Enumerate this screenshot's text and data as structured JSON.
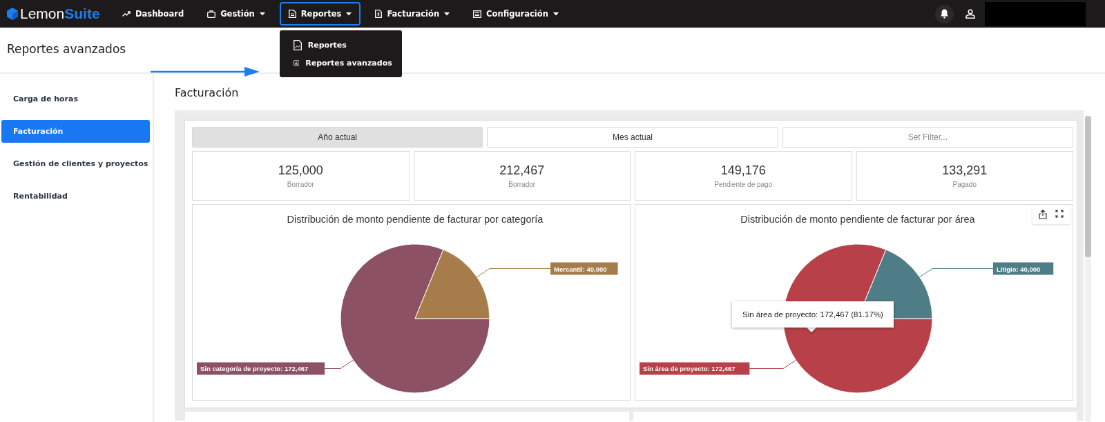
{
  "topbar": {
    "logo": {
      "first": "Lemon",
      "second": "Suite"
    },
    "items": [
      {
        "label": "Dashboard",
        "menu": false,
        "selected": false
      },
      {
        "label": "Gestión",
        "menu": true,
        "selected": false
      },
      {
        "label": "Reportes",
        "menu": true,
        "selected": true
      },
      {
        "label": "Facturación",
        "menu": true,
        "selected": false
      },
      {
        "label": "Configuración",
        "menu": true,
        "selected": false
      }
    ]
  },
  "dropdown": {
    "items": [
      {
        "label": "Reportes"
      },
      {
        "label": "Reportes avanzados"
      }
    ]
  },
  "page_title": "Reportes avanzados",
  "sidebar": {
    "items": [
      {
        "label": "Carga de horas",
        "selected": false
      },
      {
        "label": "Facturación",
        "selected": true
      },
      {
        "label": "Gestión de clientes y proyectos",
        "selected": false
      },
      {
        "label": "Rentabilidad",
        "selected": false
      }
    ]
  },
  "section_title": "Facturación",
  "filters": [
    {
      "label": "Año actual",
      "kind": "toggle",
      "selected": true
    },
    {
      "label": "Mes actual",
      "kind": "toggle",
      "selected": false
    },
    {
      "label": "Set Filter...",
      "kind": "filter",
      "selected": false
    }
  ],
  "kpis": [
    {
      "value": "125,000",
      "label": "Borrador"
    },
    {
      "value": "212,467",
      "label": "Borrador"
    },
    {
      "value": "149,176",
      "label": "Pendiente de pago"
    },
    {
      "value": "133,291",
      "label": "Pagado"
    }
  ],
  "charts": [
    {
      "chart_data": {
        "type": "pie",
        "title": "Distribución de monto pendiente de facturar por categoría",
        "values": [
          172467,
          40000
        ],
        "colors": [
          "#8c5163",
          "#a67c4b"
        ],
        "value_labels": [
          "Sin categoría de proyecto: 172,467",
          "Mercantil: 40,000"
        ]
      }
    },
    {
      "chart_data": {
        "type": "pie",
        "title": "Distribución de monto pendiente de facturar por área",
        "values": [
          172467,
          40000
        ],
        "colors": [
          "#b84049",
          "#4e7d87"
        ],
        "value_labels": [
          "Sin área de proyecto: 172,467",
          "Litigio: 40,000"
        ]
      },
      "tooltip": "Sin área de proyecto: 172,467 (81.17%)",
      "export_tools": true
    }
  ]
}
